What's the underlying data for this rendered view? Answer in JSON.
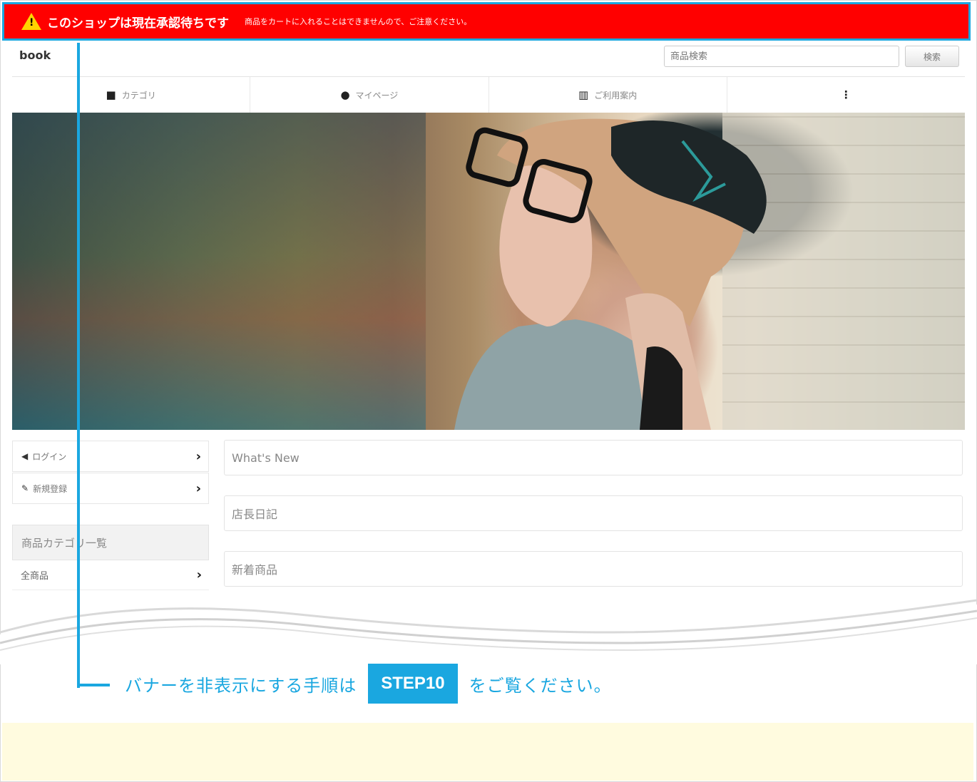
{
  "banner": {
    "title": "このショップは現在承認待ちです",
    "subtitle": "商品をカートに入れることはできませんので、ご注意ください。"
  },
  "header": {
    "brand": "book",
    "search_placeholder": "商品検索",
    "search_button": "検索"
  },
  "nav": {
    "items": [
      {
        "icon": "folder-icon",
        "label": "カテゴリ"
      },
      {
        "icon": "user-icon",
        "label": "マイページ"
      },
      {
        "icon": "map-icon",
        "label": "ご利用案内"
      },
      {
        "icon": "more-vertical-icon",
        "label": "⋮"
      }
    ]
  },
  "sidebar": {
    "login": "ログイン",
    "register": "新規登録",
    "category_heading": "商品カテゴリ一覧",
    "all_products": "全商品",
    "chevron": "›"
  },
  "main": {
    "panels": [
      "What's New",
      "店長日記",
      "新着商品"
    ]
  },
  "annotation": {
    "before": "バナーを非表示にする手順は",
    "step": "STEP10",
    "after": "をご覧ください。"
  },
  "colors": {
    "banner_red": "#ff0000",
    "accent_blue": "#1aa7e0",
    "footer_cream": "#fffbdf"
  }
}
